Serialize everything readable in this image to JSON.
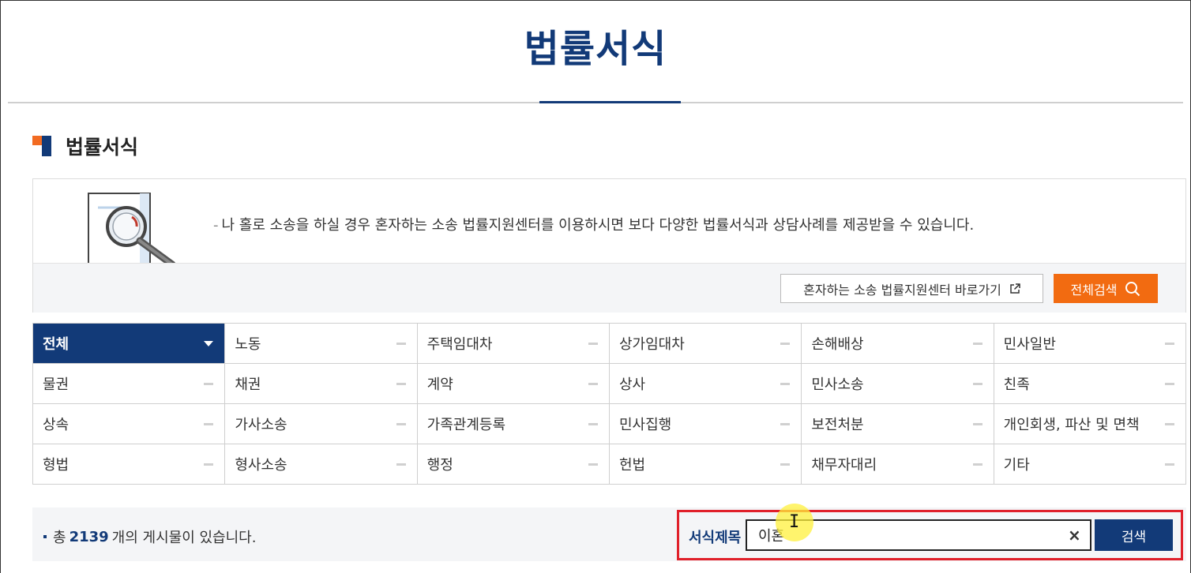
{
  "page": {
    "title": "법률서식"
  },
  "section": {
    "title": "법률서식"
  },
  "info": {
    "text": "나 홀로 소송을 하실 경우 혼자하는 소송 법률지원센터를 이용하시면 보다 다양한 법률서식과 상담사례를 제공받을 수 있습니다.",
    "link_label": "혼자하는 소송 법률지원센터 바로가기",
    "search_all_label": "전체검색"
  },
  "categories": [
    {
      "label": "전체",
      "active": true
    },
    {
      "label": "노동"
    },
    {
      "label": "주택임대차"
    },
    {
      "label": "상가임대차"
    },
    {
      "label": "손해배상"
    },
    {
      "label": "민사일반"
    },
    {
      "label": "물권"
    },
    {
      "label": "채권"
    },
    {
      "label": "계약"
    },
    {
      "label": "상사"
    },
    {
      "label": "민사소송"
    },
    {
      "label": "친족"
    },
    {
      "label": "상속"
    },
    {
      "label": "가사소송"
    },
    {
      "label": "가족관계등록"
    },
    {
      "label": "민사집행"
    },
    {
      "label": "보전처분"
    },
    {
      "label": "개인회생, 파산 및 면책"
    },
    {
      "label": "형법"
    },
    {
      "label": "형사소송"
    },
    {
      "label": "행정"
    },
    {
      "label": "헌법"
    },
    {
      "label": "채무자대리"
    },
    {
      "label": "기타"
    }
  ],
  "result": {
    "prefix": "총",
    "count": "2139",
    "suffix": "개의 게시물이 있습니다."
  },
  "search": {
    "label": "서식제목",
    "value": "이혼",
    "clear_label": "×",
    "button_label": "검색"
  },
  "colors": {
    "brand": "#123a78",
    "accent": "#f26b11",
    "highlight": "#e0202a"
  }
}
